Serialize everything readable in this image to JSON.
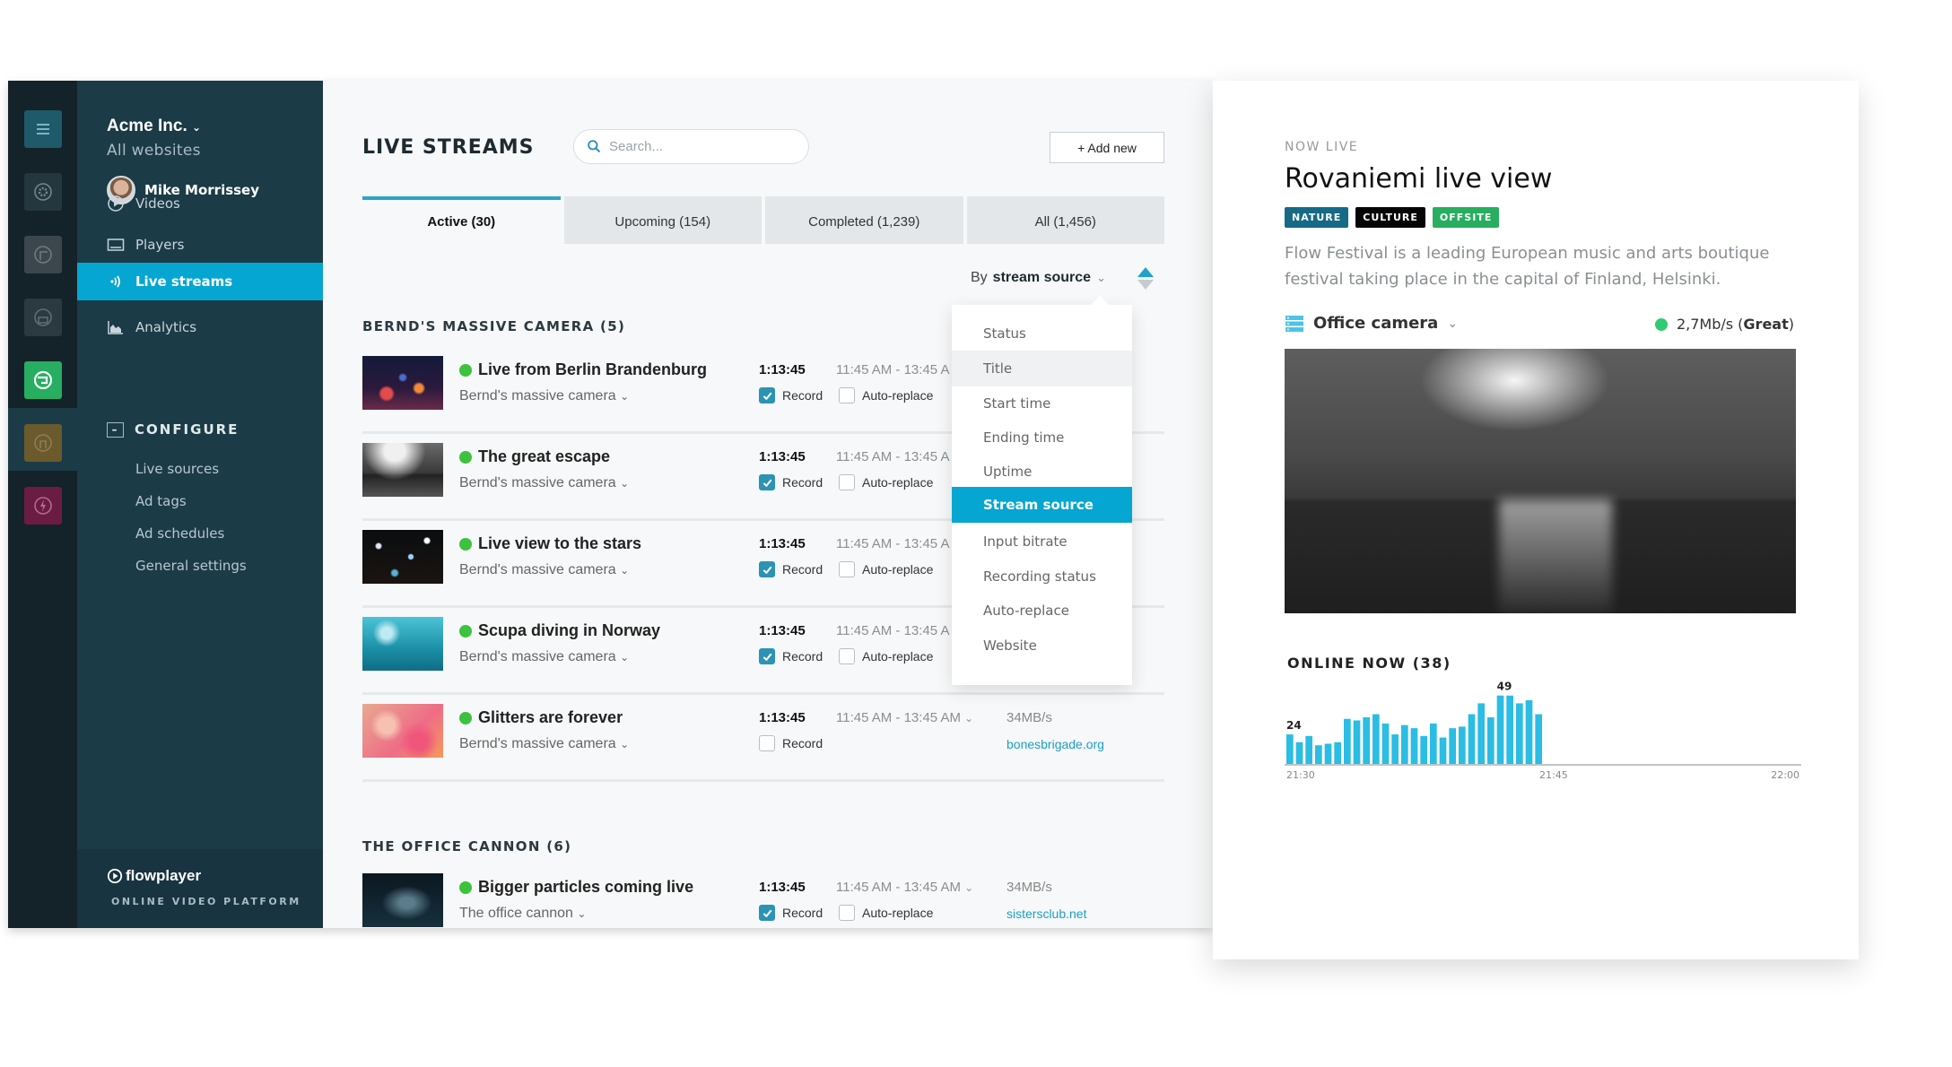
{
  "rail": {
    "items": [
      {
        "name": "menu-icon",
        "color": "#1e5a6a"
      },
      {
        "name": "settings-icon",
        "color": "#24363e"
      },
      {
        "name": "app-icon",
        "color": "#3b474d"
      },
      {
        "name": "player-app-icon",
        "color": "#2b3a41"
      },
      {
        "name": "live-app-icon",
        "color": "#27ae60"
      },
      {
        "name": "globe-app-icon",
        "color": "#6b5a2c"
      },
      {
        "name": "flash-app-icon",
        "color": "#6a1c43"
      }
    ]
  },
  "sidebar": {
    "org_name": "Acme Inc.",
    "org_sub": "All websites",
    "user_name": "Mike Morrissey",
    "nav": [
      {
        "label": "Videos",
        "icon": "play-circle-icon"
      },
      {
        "label": "Players",
        "icon": "player-icon"
      },
      {
        "label": "Live streams",
        "icon": "live-signal-icon",
        "active": true
      },
      {
        "label": "Analytics",
        "icon": "analytics-icon"
      }
    ],
    "configure_label": "CONFIGURE",
    "configure_items": [
      "Live sources",
      "Ad tags",
      "Ad schedules",
      "General settings"
    ],
    "brand": "flowplayer",
    "brand_sub": "ONLINE VIDEO PLATFORM"
  },
  "main": {
    "title": "LIVE STREAMS",
    "search_placeholder": "Search...",
    "add_button": "+ Add new",
    "tabs": [
      {
        "label": "Active (30)",
        "active": true
      },
      {
        "label": "Upcoming (154)"
      },
      {
        "label": "Completed (1,239)"
      },
      {
        "label": "All (1,456)"
      }
    ],
    "sort_prefix": "By",
    "sort_value": "stream source",
    "sort_menu": {
      "items": [
        "Status",
        "Title",
        "Start time",
        "Ending time",
        "Uptime",
        "Stream source",
        "Input bitrate",
        "Recording status",
        "Auto-replace",
        "Website"
      ],
      "hovered": "Title",
      "selected": "Stream source"
    },
    "groups": [
      {
        "title": "BERND'S MASSIVE CAMERA (5)",
        "rows": [
          {
            "title": "Live from Berlin Brandenburg",
            "source": "Bernd's massive camera",
            "uptime": "1:13:45",
            "time": "11:45 AM - 13:45 A",
            "record": true,
            "auto_replace": false,
            "show_auto": true,
            "bitrate": "",
            "site": "",
            "thumb": "city"
          },
          {
            "title": "The great escape",
            "source": "Bernd's massive camera",
            "uptime": "1:13:45",
            "time": "11:45 AM - 13:45 A",
            "record": true,
            "auto_replace": false,
            "show_auto": true,
            "bitrate": "",
            "site": "",
            "thumb": "sea"
          },
          {
            "title": "Live view to the stars",
            "source": "Bernd's massive camera",
            "uptime": "1:13:45",
            "time": "11:45 AM - 13:45 A",
            "record": true,
            "auto_replace": false,
            "show_auto": true,
            "bitrate": "",
            "site": "",
            "thumb": "stars"
          },
          {
            "title": "Scupa diving in Norway",
            "source": "Bernd's massive camera",
            "uptime": "1:13:45",
            "time": "11:45 AM - 13:45 A",
            "record": true,
            "auto_replace": false,
            "show_auto": true,
            "bitrate": "",
            "site": "",
            "thumb": "water"
          },
          {
            "title": "Glitters are forever",
            "source": "Bernd's massive camera",
            "uptime": "1:13:45",
            "time": "11:45 AM - 13:45 AM",
            "record": false,
            "auto_replace": false,
            "show_auto": false,
            "bitrate": "34MB/s",
            "site": "bonesbrigade.org",
            "thumb": "glitter"
          }
        ]
      },
      {
        "title": "THE OFFICE CANNON (6)",
        "rows": [
          {
            "title": "Bigger particles coming live",
            "source": "The office cannon",
            "uptime": "1:13:45",
            "time": "11:45 AM - 13:45 AM",
            "record": true,
            "auto_replace": false,
            "show_auto": true,
            "bitrate": "34MB/s",
            "site": "sistersclub.net",
            "thumb": "particles"
          }
        ]
      }
    ],
    "record_label": "Record",
    "auto_label": "Auto-replace"
  },
  "panel": {
    "kicker": "NOW LIVE",
    "title": "Rovaniemi live view",
    "tags": [
      {
        "label": "NATURE",
        "color": "#176a86"
      },
      {
        "label": "CULTURE",
        "color": "#050505"
      },
      {
        "label": "OFFSITE",
        "color": "#27ae60"
      }
    ],
    "description": "Flow Festival is a leading European music and arts boutique festival taking place in the capital of Finland, Helsinki.",
    "camera": "Office camera",
    "bitrate_value": "2,7Mb/s (",
    "bitrate_quality": "Great",
    "bitrate_close": ")"
  },
  "chart_data": {
    "type": "bar",
    "title": "ONLINE NOW (38)",
    "x_ticks": [
      "21:30",
      "21:45",
      "22:00"
    ],
    "values": [
      24,
      19,
      23,
      17,
      18,
      19,
      34,
      33,
      35,
      37,
      31,
      24,
      30,
      28,
      23,
      31,
      22,
      28,
      29,
      37,
      44,
      35,
      49,
      49,
      44,
      46,
      37
    ],
    "annotations": [
      {
        "index": 0,
        "label": "24"
      },
      {
        "index": 22,
        "label": "49"
      }
    ],
    "slots": 54,
    "ylim": [
      5,
      50
    ],
    "color": "#2bbde3",
    "grid": false
  }
}
